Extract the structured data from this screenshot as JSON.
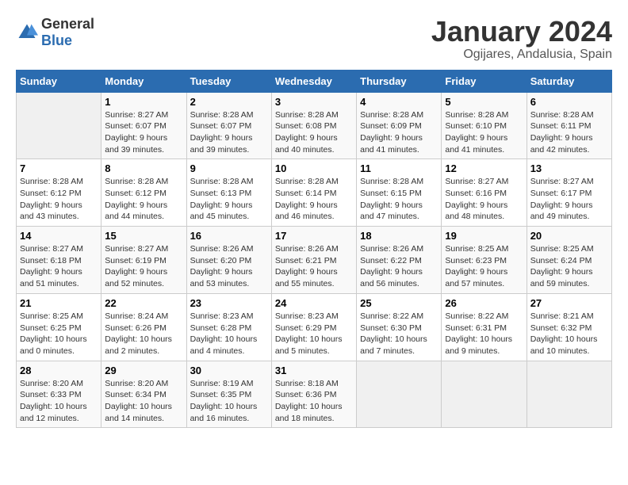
{
  "logo": {
    "general": "General",
    "blue": "Blue"
  },
  "title": "January 2024",
  "subtitle": "Ogijares, Andalusia, Spain",
  "days_of_week": [
    "Sunday",
    "Monday",
    "Tuesday",
    "Wednesday",
    "Thursday",
    "Friday",
    "Saturday"
  ],
  "weeks": [
    [
      {
        "num": "",
        "sunrise": "",
        "sunset": "",
        "daylight": ""
      },
      {
        "num": "1",
        "sunrise": "Sunrise: 8:27 AM",
        "sunset": "Sunset: 6:07 PM",
        "daylight": "Daylight: 9 hours and 39 minutes."
      },
      {
        "num": "2",
        "sunrise": "Sunrise: 8:28 AM",
        "sunset": "Sunset: 6:07 PM",
        "daylight": "Daylight: 9 hours and 39 minutes."
      },
      {
        "num": "3",
        "sunrise": "Sunrise: 8:28 AM",
        "sunset": "Sunset: 6:08 PM",
        "daylight": "Daylight: 9 hours and 40 minutes."
      },
      {
        "num": "4",
        "sunrise": "Sunrise: 8:28 AM",
        "sunset": "Sunset: 6:09 PM",
        "daylight": "Daylight: 9 hours and 41 minutes."
      },
      {
        "num": "5",
        "sunrise": "Sunrise: 8:28 AM",
        "sunset": "Sunset: 6:10 PM",
        "daylight": "Daylight: 9 hours and 41 minutes."
      },
      {
        "num": "6",
        "sunrise": "Sunrise: 8:28 AM",
        "sunset": "Sunset: 6:11 PM",
        "daylight": "Daylight: 9 hours and 42 minutes."
      }
    ],
    [
      {
        "num": "7",
        "sunrise": "Sunrise: 8:28 AM",
        "sunset": "Sunset: 6:12 PM",
        "daylight": "Daylight: 9 hours and 43 minutes."
      },
      {
        "num": "8",
        "sunrise": "Sunrise: 8:28 AM",
        "sunset": "Sunset: 6:12 PM",
        "daylight": "Daylight: 9 hours and 44 minutes."
      },
      {
        "num": "9",
        "sunrise": "Sunrise: 8:28 AM",
        "sunset": "Sunset: 6:13 PM",
        "daylight": "Daylight: 9 hours and 45 minutes."
      },
      {
        "num": "10",
        "sunrise": "Sunrise: 8:28 AM",
        "sunset": "Sunset: 6:14 PM",
        "daylight": "Daylight: 9 hours and 46 minutes."
      },
      {
        "num": "11",
        "sunrise": "Sunrise: 8:28 AM",
        "sunset": "Sunset: 6:15 PM",
        "daylight": "Daylight: 9 hours and 47 minutes."
      },
      {
        "num": "12",
        "sunrise": "Sunrise: 8:27 AM",
        "sunset": "Sunset: 6:16 PM",
        "daylight": "Daylight: 9 hours and 48 minutes."
      },
      {
        "num": "13",
        "sunrise": "Sunrise: 8:27 AM",
        "sunset": "Sunset: 6:17 PM",
        "daylight": "Daylight: 9 hours and 49 minutes."
      }
    ],
    [
      {
        "num": "14",
        "sunrise": "Sunrise: 8:27 AM",
        "sunset": "Sunset: 6:18 PM",
        "daylight": "Daylight: 9 hours and 51 minutes."
      },
      {
        "num": "15",
        "sunrise": "Sunrise: 8:27 AM",
        "sunset": "Sunset: 6:19 PM",
        "daylight": "Daylight: 9 hours and 52 minutes."
      },
      {
        "num": "16",
        "sunrise": "Sunrise: 8:26 AM",
        "sunset": "Sunset: 6:20 PM",
        "daylight": "Daylight: 9 hours and 53 minutes."
      },
      {
        "num": "17",
        "sunrise": "Sunrise: 8:26 AM",
        "sunset": "Sunset: 6:21 PM",
        "daylight": "Daylight: 9 hours and 55 minutes."
      },
      {
        "num": "18",
        "sunrise": "Sunrise: 8:26 AM",
        "sunset": "Sunset: 6:22 PM",
        "daylight": "Daylight: 9 hours and 56 minutes."
      },
      {
        "num": "19",
        "sunrise": "Sunrise: 8:25 AM",
        "sunset": "Sunset: 6:23 PM",
        "daylight": "Daylight: 9 hours and 57 minutes."
      },
      {
        "num": "20",
        "sunrise": "Sunrise: 8:25 AM",
        "sunset": "Sunset: 6:24 PM",
        "daylight": "Daylight: 9 hours and 59 minutes."
      }
    ],
    [
      {
        "num": "21",
        "sunrise": "Sunrise: 8:25 AM",
        "sunset": "Sunset: 6:25 PM",
        "daylight": "Daylight: 10 hours and 0 minutes."
      },
      {
        "num": "22",
        "sunrise": "Sunrise: 8:24 AM",
        "sunset": "Sunset: 6:26 PM",
        "daylight": "Daylight: 10 hours and 2 minutes."
      },
      {
        "num": "23",
        "sunrise": "Sunrise: 8:23 AM",
        "sunset": "Sunset: 6:28 PM",
        "daylight": "Daylight: 10 hours and 4 minutes."
      },
      {
        "num": "24",
        "sunrise": "Sunrise: 8:23 AM",
        "sunset": "Sunset: 6:29 PM",
        "daylight": "Daylight: 10 hours and 5 minutes."
      },
      {
        "num": "25",
        "sunrise": "Sunrise: 8:22 AM",
        "sunset": "Sunset: 6:30 PM",
        "daylight": "Daylight: 10 hours and 7 minutes."
      },
      {
        "num": "26",
        "sunrise": "Sunrise: 8:22 AM",
        "sunset": "Sunset: 6:31 PM",
        "daylight": "Daylight: 10 hours and 9 minutes."
      },
      {
        "num": "27",
        "sunrise": "Sunrise: 8:21 AM",
        "sunset": "Sunset: 6:32 PM",
        "daylight": "Daylight: 10 hours and 10 minutes."
      }
    ],
    [
      {
        "num": "28",
        "sunrise": "Sunrise: 8:20 AM",
        "sunset": "Sunset: 6:33 PM",
        "daylight": "Daylight: 10 hours and 12 minutes."
      },
      {
        "num": "29",
        "sunrise": "Sunrise: 8:20 AM",
        "sunset": "Sunset: 6:34 PM",
        "daylight": "Daylight: 10 hours and 14 minutes."
      },
      {
        "num": "30",
        "sunrise": "Sunrise: 8:19 AM",
        "sunset": "Sunset: 6:35 PM",
        "daylight": "Daylight: 10 hours and 16 minutes."
      },
      {
        "num": "31",
        "sunrise": "Sunrise: 8:18 AM",
        "sunset": "Sunset: 6:36 PM",
        "daylight": "Daylight: 10 hours and 18 minutes."
      },
      {
        "num": "",
        "sunrise": "",
        "sunset": "",
        "daylight": ""
      },
      {
        "num": "",
        "sunrise": "",
        "sunset": "",
        "daylight": ""
      },
      {
        "num": "",
        "sunrise": "",
        "sunset": "",
        "daylight": ""
      }
    ]
  ]
}
